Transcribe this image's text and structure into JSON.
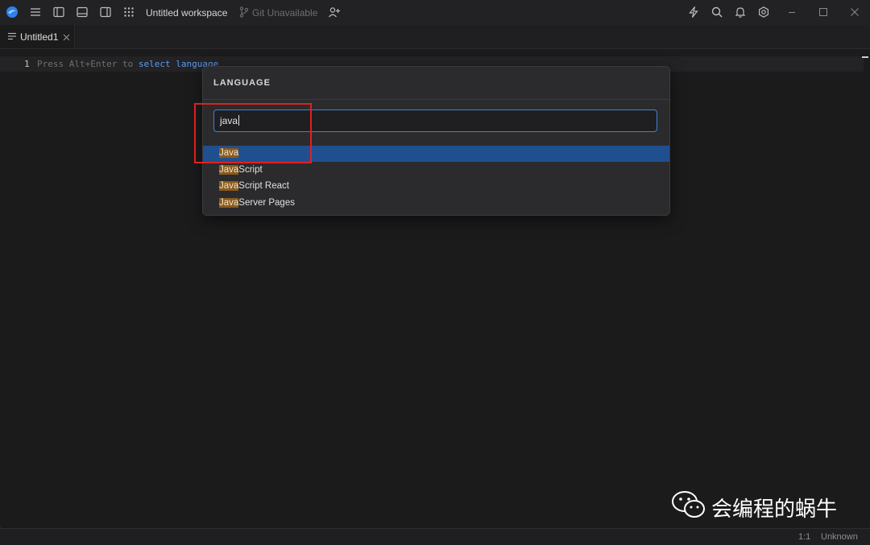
{
  "titlebar": {
    "workspace": "Untitled workspace",
    "git_status": "Git Unavailable"
  },
  "tabs": [
    {
      "label": "Untitled1"
    }
  ],
  "editor": {
    "line_number": "1",
    "placeholder_prefix": "Press Alt+Enter to",
    "placeholder_keyword1": "select",
    "placeholder_keyword2": "language"
  },
  "language_picker": {
    "title": "LANGUAGE",
    "query": "java",
    "items": [
      {
        "match": "Java",
        "rest": "",
        "selected": true
      },
      {
        "match": "Java",
        "rest": "Script",
        "selected": false
      },
      {
        "match": "Java",
        "rest": "Script React",
        "selected": false
      },
      {
        "match": "Java",
        "rest": "Server Pages",
        "selected": false
      }
    ]
  },
  "statusbar": {
    "cursor": "1:1",
    "language": "Unknown"
  },
  "watermark": {
    "text": "会编程的蜗牛"
  },
  "colors": {
    "accent": "#3b82d4",
    "selection": "#1f4f8f",
    "match_highlight": "#8a5a1e",
    "annotation_box": "#e02020"
  },
  "icons": [
    "app-logo-icon",
    "menu-icon",
    "toggle-sidebar-icon",
    "toggle-panel-icon",
    "toggle-right-sidebar-icon",
    "apps-grid-icon",
    "git-branch-icon",
    "add-collaborator-icon",
    "lightning-icon",
    "search-icon",
    "bell-icon",
    "settings-icon",
    "minimize-icon",
    "maximize-icon",
    "close-icon",
    "file-lines-icon",
    "tab-close-icon",
    "wechat-icon"
  ]
}
